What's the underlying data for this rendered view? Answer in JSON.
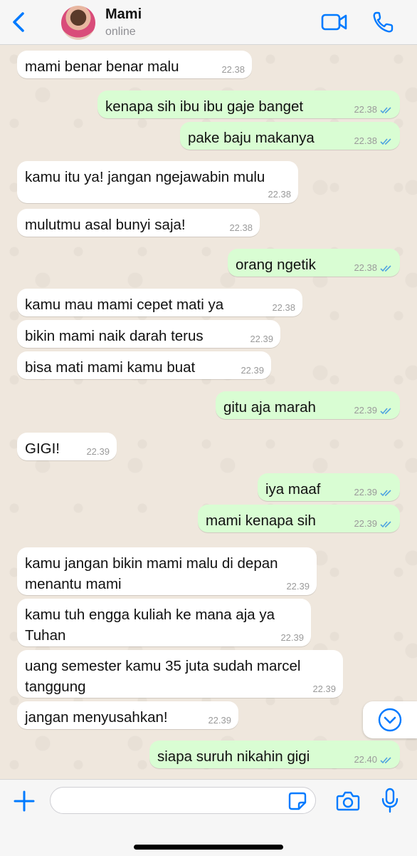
{
  "header": {
    "contact_name": "Mami",
    "status": "online"
  },
  "composer": {
    "input_value": "",
    "input_placeholder": ""
  },
  "colors": {
    "accent": "#007aff",
    "incoming_bubble": "#ffffff",
    "outgoing_bubble": "#d9fdd3",
    "read_ticks": "#4fa3e0"
  },
  "messages": [
    {
      "dir": "in",
      "text": "mami benar benar malu",
      "time": "22.38"
    },
    {
      "dir": "out",
      "text": "kenapa sih ibu ibu gaje banget",
      "time": "22.38"
    },
    {
      "dir": "out",
      "text": "pake baju makanya",
      "time": "22.38"
    },
    {
      "dir": "in",
      "text": "kamu itu ya! jangan ngejawabin mulu",
      "time": "22.38"
    },
    {
      "dir": "in",
      "text": "mulutmu asal bunyi saja!",
      "time": "22.38"
    },
    {
      "dir": "out",
      "text": "orang ngetik",
      "time": "22.38"
    },
    {
      "dir": "in",
      "text": "kamu mau mami cepet mati ya",
      "time": "22.38"
    },
    {
      "dir": "in",
      "text": "bikin mami naik darah terus",
      "time": "22.39"
    },
    {
      "dir": "in",
      "text": "bisa mati mami kamu buat",
      "time": "22.39"
    },
    {
      "dir": "out",
      "text": "gitu aja marah",
      "time": "22.39"
    },
    {
      "dir": "in",
      "text": "GIGI!",
      "time": "22.39"
    },
    {
      "dir": "out",
      "text": "iya maaf",
      "time": "22.39"
    },
    {
      "dir": "out",
      "text": "mami kenapa sih",
      "time": "22.39"
    },
    {
      "dir": "in",
      "text": "kamu jangan bikin mami malu di depan menantu mami",
      "time": "22.39"
    },
    {
      "dir": "in",
      "text": "kamu tuh engga kuliah ke mana aja ya Tuhan",
      "time": "22.39"
    },
    {
      "dir": "in",
      "text": "uang semester kamu 35 juta sudah marcel tanggung",
      "time": "22.39"
    },
    {
      "dir": "in",
      "text": "jangan menyusahkan!",
      "time": "22.39"
    },
    {
      "dir": "out",
      "text": "siapa suruh nikahin gigi",
      "time": "22.40"
    }
  ]
}
